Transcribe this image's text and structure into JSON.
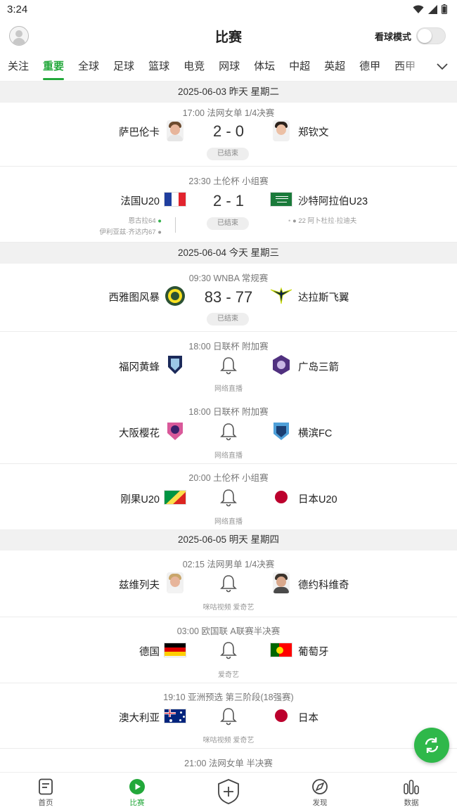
{
  "status_bar": {
    "time": "3:24"
  },
  "header": {
    "title": "比赛",
    "watch_mode_label": "看球模式",
    "watch_mode_on": false
  },
  "tabs": [
    "关注",
    "重要",
    "全球",
    "足球",
    "篮球",
    "电竞",
    "网球",
    "体坛",
    "中超",
    "英超",
    "德甲",
    "西甲"
  ],
  "active_tab": "重要",
  "sections": [
    {
      "date": "2025-06-03 昨天 星期二"
    },
    {
      "date": "2025-06-04 今天 星期三"
    },
    {
      "date": "2025-06-05 明天 星期四"
    }
  ],
  "matches": [
    {
      "time_league": "17:00 法网女单 1/4决赛",
      "home": "萨巴伦卡",
      "away": "郑钦文",
      "score": "2 - 0",
      "status": "已结束"
    },
    {
      "time_league": "23:30 土伦杯 小组赛",
      "home": "法国U20",
      "away": "沙特阿拉伯U23",
      "score": "2 - 1",
      "status": "已结束",
      "home_scorers": [
        "恩古拉64",
        "伊利亚兹·齐达内67"
      ],
      "away_scorers": [
        "22 阿卜杜拉·拉迪夫"
      ]
    },
    {
      "time_league": "09:30 WNBA 常规赛",
      "home": "西雅图风暴",
      "away": "达拉斯飞翼",
      "score": "83 - 77",
      "status": "已结束"
    },
    {
      "time_league": "18:00 日联杯 附加赛",
      "home": "福冈黄蜂",
      "away": "广岛三箭",
      "broadcast": "网络直播"
    },
    {
      "time_league": "18:00 日联杯 附加赛",
      "home": "大阪樱花",
      "away": "横滨FC",
      "broadcast": "网络直播"
    },
    {
      "time_league": "20:00 土伦杯 小组赛",
      "home": "刚果U20",
      "away": "日本U20",
      "broadcast": "网络直播"
    },
    {
      "time_league": "02:15 法网男单 1/4决赛",
      "home": "兹维列夫",
      "away": "德约科维奇",
      "broadcast": "咪咕视频 爱奇艺"
    },
    {
      "time_league": "03:00 欧国联 A联赛半决赛",
      "home": "德国",
      "away": "葡萄牙",
      "broadcast": "爱奇艺"
    },
    {
      "time_league": "19:10 亚洲预选 第三阶段(18强赛)",
      "home": "澳大利亚",
      "away": "日本",
      "broadcast": "咪咕视频 爱奇艺"
    },
    {
      "time_league": "21:00 法网女单 半决赛"
    }
  ],
  "bottom_nav": [
    {
      "label": "首页",
      "icon": "home-doc-icon"
    },
    {
      "label": "比赛",
      "icon": "play-circle-icon",
      "active": true
    },
    {
      "label": "",
      "icon": "shield-plus-icon"
    },
    {
      "label": "发现",
      "icon": "discover-icon"
    },
    {
      "label": "数据",
      "icon": "data-bars-icon"
    }
  ],
  "colors": {
    "accent": "#22a83a",
    "section_bg": "#f1f1f1"
  }
}
